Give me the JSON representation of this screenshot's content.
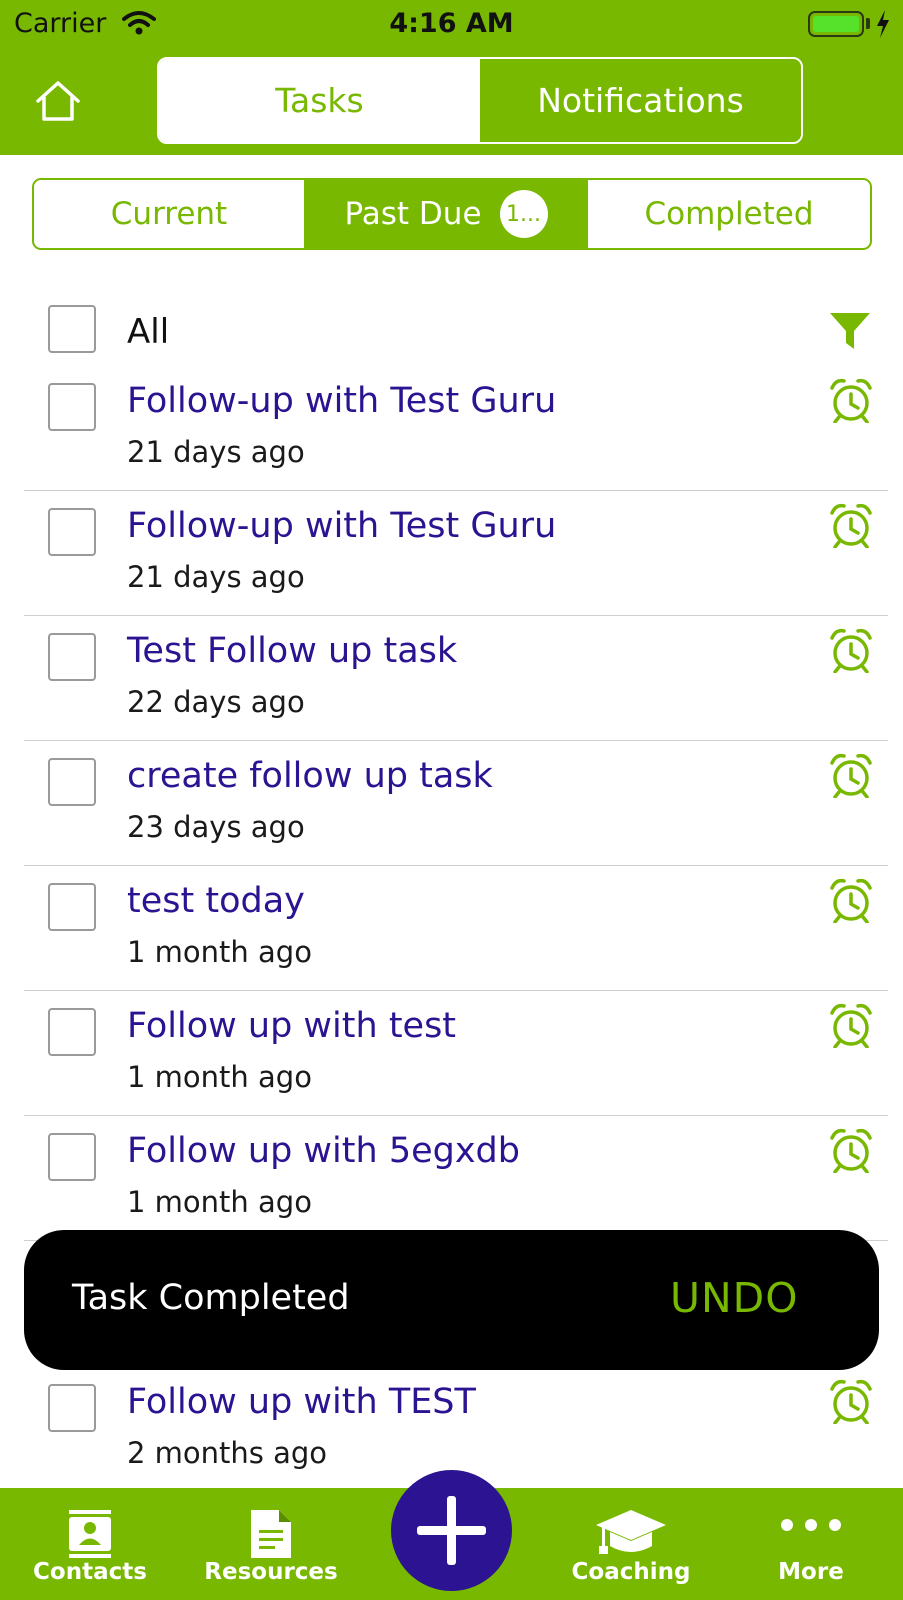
{
  "status_bar": {
    "carrier": "Carrier",
    "time": "4:16 AM"
  },
  "header": {
    "tabs": [
      {
        "label": "Tasks",
        "active": true
      },
      {
        "label": "Notifications",
        "active": false
      }
    ]
  },
  "filter_tabs": [
    {
      "label": "Current",
      "active": false
    },
    {
      "label": "Past Due",
      "active": true,
      "badge": "1..."
    },
    {
      "label": "Completed",
      "active": false
    }
  ],
  "select_all": {
    "label": "All"
  },
  "tasks": [
    {
      "title": "Follow-up with Test Guru",
      "ago": "21 days ago"
    },
    {
      "title": "Follow-up with Test Guru",
      "ago": "21 days ago"
    },
    {
      "title": "Test Follow up task",
      "ago": "22 days ago"
    },
    {
      "title": "create follow up task",
      "ago": "23 days ago"
    },
    {
      "title": "test today",
      "ago": "1 month ago"
    },
    {
      "title": "Follow up with test",
      "ago": "1 month ago"
    },
    {
      "title": "Follow up with 5egxdb",
      "ago": "1 month ago"
    },
    {
      "title": "Follow up with TEST",
      "ago": "2 months ago"
    }
  ],
  "toast": {
    "message": "Task Completed",
    "action": "UNDO"
  },
  "bottom_tabs": [
    {
      "label": "Contacts",
      "icon": "contacts-icon"
    },
    {
      "label": "Resources",
      "icon": "document-icon"
    },
    {
      "label": "Coaching",
      "icon": "graduation-cap-icon"
    },
    {
      "label": "More",
      "icon": "more-dots-icon"
    }
  ],
  "fab_icon": "plus-icon",
  "colors": {
    "brand_green": "#78b800",
    "task_title": "#2b1391",
    "fab": "#2b1391",
    "toast_bg": "#000000"
  }
}
